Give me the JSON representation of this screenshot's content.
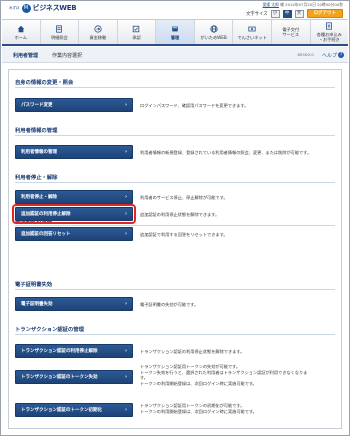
{
  "header": {
    "logo_small": "みずほ",
    "logo_mark": "M",
    "logo_text": "ビジネスWEB",
    "user_name": "愛媛 太郎",
    "user_suffix": " 様 2014年07月20日 20時00分00秒",
    "text_size_label": "文字サイズ",
    "size_small": "小",
    "size_medium": "中",
    "size_large": "大",
    "logout": "ログアウト"
  },
  "nav": [
    {
      "icon": "home-icon",
      "label": "ホーム"
    },
    {
      "icon": "statement-icon",
      "label": "明細照会"
    },
    {
      "icon": "transfer-icon",
      "label": "資金移動"
    },
    {
      "icon": "approval-icon",
      "label": "承認"
    },
    {
      "icon": "admin-icon",
      "label": "管理",
      "active": true
    },
    {
      "icon": "gaitame-icon",
      "label": "がいためWEB"
    },
    {
      "icon": "densai-icon",
      "label": "でんさいネット"
    },
    {
      "icon": "e-service-icon",
      "label": "電子交付\nサービス"
    },
    {
      "icon": "application-icon",
      "label": "各種お申込み\n・お手続き"
    }
  ],
  "breadcrumb": {
    "title": "利用者管理",
    "subtitle": "作業内容選択",
    "screen_id": "BRSK001",
    "help": "ヘルプ",
    "help_icon": "?"
  },
  "sections": {
    "self_info": "自身の情報の変更・照会",
    "user_info": "利用者情報の管理",
    "user_stop": "利用者停止・解除",
    "auth": "追加認証の管理",
    "cert": "電子証明書失効",
    "transaction": "トランザクション認証の管理"
  },
  "buttons": {
    "password": "パスワード変更",
    "user_manage": "利用者情報の管理",
    "user_stop": "利用者停止・解除",
    "auth_unlock": "追加認証の利用停止解除",
    "auth_reset": "追加認証の回答リセット",
    "cert_revoke": "電子証明書失効",
    "tx_unlock": "トランザクション認証の利用停止解除",
    "tx_revoke": "トランザクション認証のトークン失効",
    "tx_init": "トランザクション認証のトークン初期化"
  },
  "descriptions": {
    "password": "ログインパスワード、確認用パスワードを変更できます。",
    "user_manage": "利用者情報の新規登録、登録されている利用者情報の照会、変更、または削除が可能です。",
    "user_stop": "利用者のサービス停止、停止解除が可能です。",
    "auth_unlock": "追加認証の利用停止状態を解除できます。",
    "auth_reset": "追加認証で利用する回答をリセットできます。",
    "cert_revoke": "電子証明書の失効が可能です。",
    "tx_unlock": "トランザクション認証の利用停止状態を解除できます。",
    "tx_revoke_1": "トランザクション認証用トークンの失効が可能です。",
    "tx_revoke_2": "トークン失効を行うと、選択された利用者はトランザクション認証が利用できなくなりま",
    "tx_revoke_3": "す。",
    "tx_revoke_4": "トークンの利用開始登録は、次回ログイン時に実施可能です。",
    "tx_init_1": "トランザクション認証用トークンの初期化が可能です。",
    "tx_init_2": "トークンの利用開始登録は、次回ログイン時に実施可能です。"
  },
  "arrow": "›",
  "colors": {
    "brand_navy": "#1b3d74",
    "button_blue": "#244e88",
    "logout_orange": "#f2a21b",
    "highlight_red": "#e02626"
  }
}
